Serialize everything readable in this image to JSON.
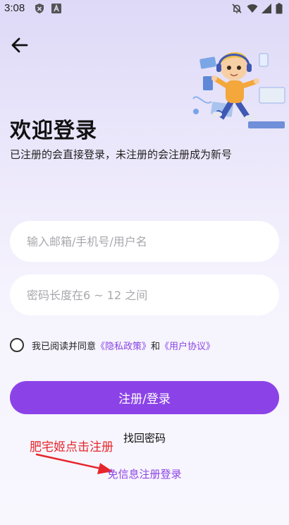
{
  "status_bar": {
    "time": "3:08",
    "icons": [
      "shield-icon",
      "font-icon",
      "mute-icon",
      "wifi-icon",
      "signal-icon",
      "battery-icon"
    ]
  },
  "header": {
    "back_icon": "arrow-left-icon"
  },
  "login": {
    "title": "欢迎登录",
    "subtitle": "已注册的会直接登录，未注册的会注册成为新号",
    "account_placeholder": "输入邮箱/手机号/用户名",
    "password_placeholder": "密码长度在6 ~ 12 之间",
    "agree_prefix": "我已阅读并同意",
    "privacy_link": "《隐私政策》",
    "agree_and": "和",
    "user_agreement_link": "《用户协议》",
    "submit_label": "注册/登录",
    "find_password": "找回密码",
    "sms_login": "免信息注册登录"
  },
  "annotation": {
    "text": "肥宅姬点击注册"
  },
  "colors": {
    "accent": "#8b43e8",
    "annotation": "#e6262b",
    "background_top": "#ddd9f7",
    "background_bottom": "#f8f7fe"
  }
}
